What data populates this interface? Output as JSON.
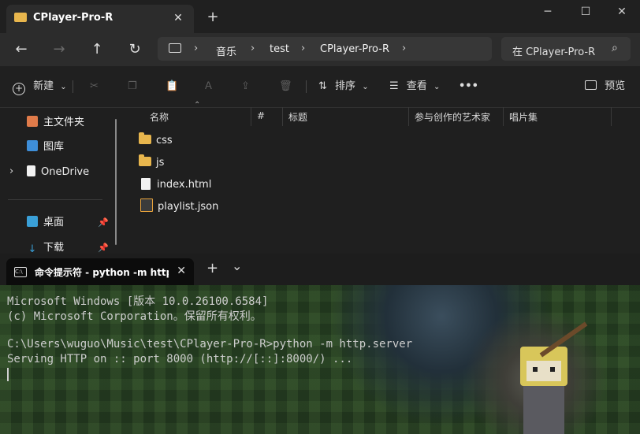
{
  "explorer": {
    "tab_title": "CPlayer-Pro-R",
    "close_label": "✕",
    "newtab_label": "+",
    "breadcrumb": [
      "音乐",
      "test",
      "CPlayer-Pro-R"
    ],
    "search_placeholder": "在 CPlayer-Pro-R",
    "toolbar": {
      "new_label": "新建",
      "sort_label": "排序",
      "view_label": "查看",
      "more_label": "•••",
      "preview_label": "预览"
    },
    "sidebar": [
      {
        "label": "主文件夹",
        "icon": "home-icon"
      },
      {
        "label": "图库",
        "icon": "gallery-icon"
      },
      {
        "label": "OneDrive",
        "icon": "onedrive-icon"
      },
      {
        "label": "桌面",
        "icon": "desktop-icon"
      },
      {
        "label": "下载",
        "icon": "download-icon"
      }
    ],
    "columns": [
      "名称",
      "#",
      "标题",
      "参与创作的艺术家",
      "唱片集"
    ],
    "files": [
      {
        "name": "css",
        "type": "folder"
      },
      {
        "name": "js",
        "type": "folder"
      },
      {
        "name": "index.html",
        "type": "html"
      },
      {
        "name": "playlist.json",
        "type": "json"
      }
    ],
    "colors": {
      "folder": "#e8b64d",
      "background": "#1f1f1f"
    }
  },
  "terminal": {
    "tab_title": "命令提示符 - python  -m http.s",
    "close_label": "✕",
    "newtab_label": "+",
    "dropdown_label": "⌄",
    "lines": [
      "Microsoft Windows [版本 10.0.26100.6584]",
      "(c) Microsoft Corporation。保留所有权利。",
      "",
      "C:\\Users\\wuguo\\Music\\test\\CPlayer-Pro-R>python -m http.server",
      "Serving HTTP on :: port 8000 (http://[::]:8000/) ..."
    ]
  }
}
